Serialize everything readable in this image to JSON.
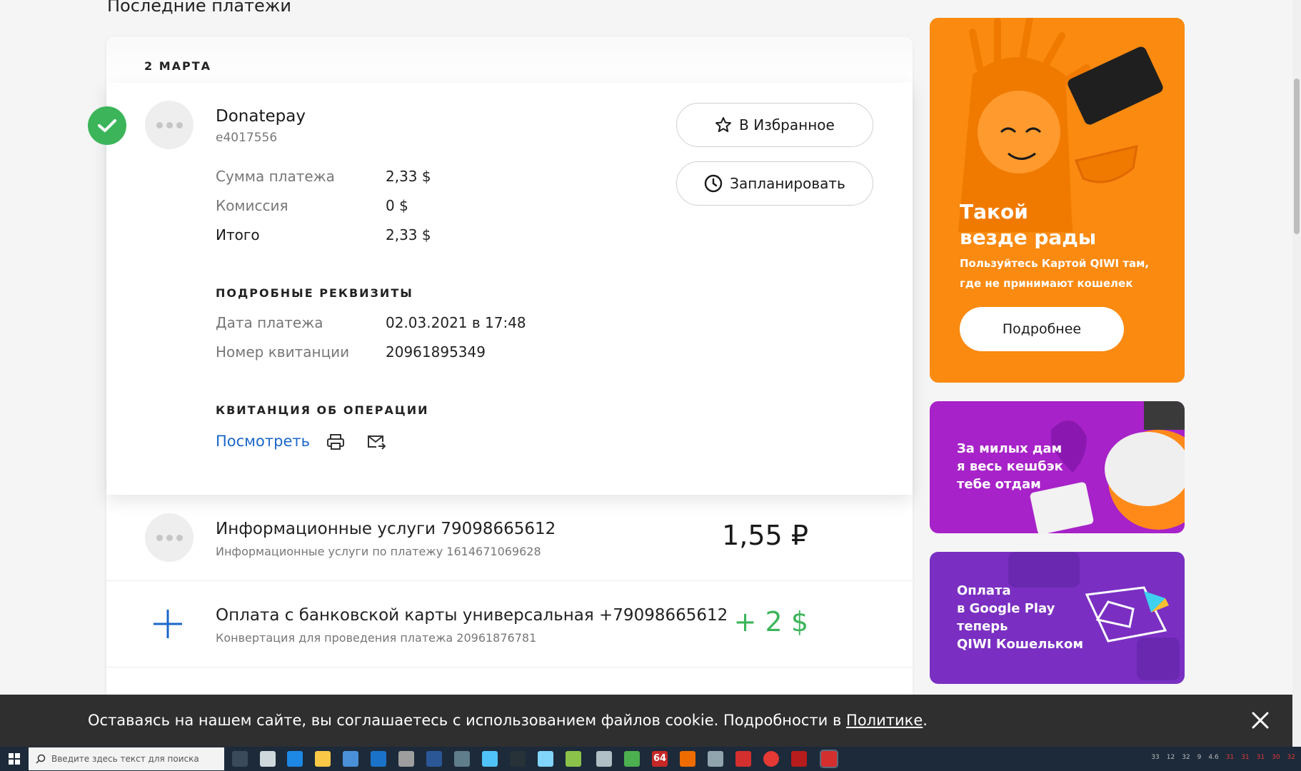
{
  "page": {
    "title": "Последние платежи"
  },
  "group": {
    "date": "2 МАРТА"
  },
  "expanded_payment": {
    "merchant": "Donatepay",
    "merchant_id": "e4017556",
    "rows": [
      {
        "label": "Сумма платежа",
        "value": "2,33 $"
      },
      {
        "label": "Комиссия",
        "value": "0 $"
      },
      {
        "label": "Итого",
        "value": "2,33 $"
      }
    ],
    "details_title": "ПОДРОБНЫЕ РЕКВИЗИТЫ",
    "details": [
      {
        "label": "Дата платежа",
        "value": "02.03.2021 в 17:48"
      },
      {
        "label": "Номер квитанции",
        "value": "20961895349"
      }
    ],
    "receipt_title": "КВИТАНЦИЯ ОБ ОПЕРАЦИИ",
    "receipt_view": "Посмотреть",
    "favorite_label": "В Избранное",
    "schedule_label": "Запланировать"
  },
  "payments": [
    {
      "title": "Информационные услуги 79098665612",
      "subtitle": "Информационные услуги по платежу 1614671069628",
      "amount": "1,55 ₽",
      "amount_color": "#1a1a1a"
    },
    {
      "title": "Оплата с банковской карты универсальная +79098665612",
      "subtitle": "Конвертация для проведения платежа 20961876781",
      "amount": "+ 2 $",
      "amount_color": "#3cb55a"
    }
  ],
  "banners": {
    "main": {
      "title": "Такой\nвезде рады",
      "subtitle": "Пользуйтесь Картой QIWI там, где не принимают кошелек",
      "button": "Подробнее",
      "color": "#fa8a10"
    },
    "cashback": {
      "text": "За милых дам\nя весь кешбэк\nтебе отдам",
      "color": "#a722c8"
    },
    "google_play": {
      "text": "Оплата\nв Google Play\nтеперь\nQIWI Кошельком",
      "color": "#7a2fc2"
    }
  },
  "cookie": {
    "text": "Оставаясь на нашем сайте, вы соглашаетесь с использованием файлов cookie. Подробности в ",
    "link": "Политике",
    "end": "."
  },
  "taskbar": {
    "search_placeholder": "Введите здесь текст для поиска",
    "badge": "64",
    "tray": [
      "33",
      "12",
      "32",
      "9",
      "4.6",
      "31",
      "31",
      "31",
      "30",
      "32"
    ]
  }
}
